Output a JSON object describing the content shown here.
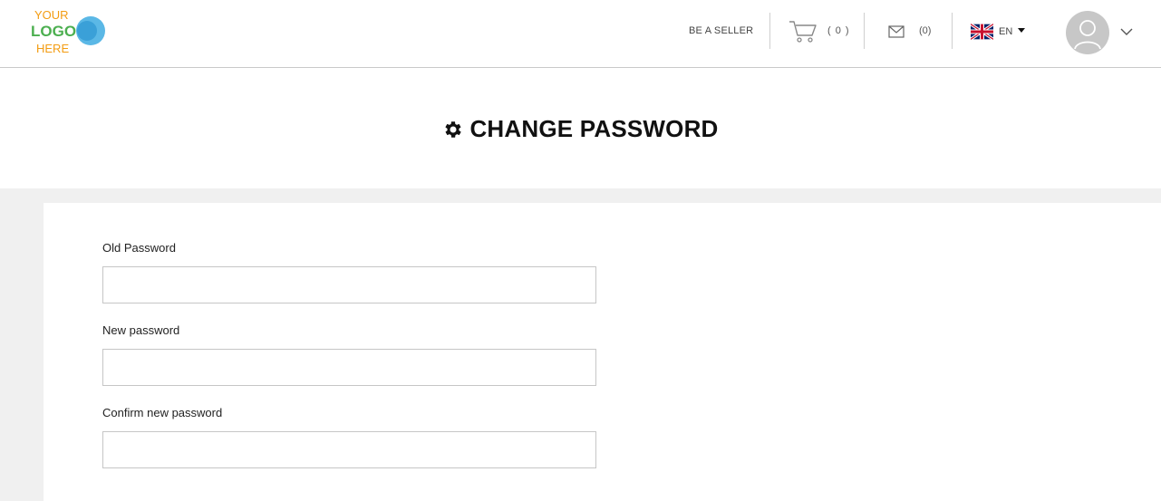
{
  "header": {
    "logo": {
      "text_lines": [
        "YOUR",
        "LOGO",
        "HERE"
      ],
      "colors": {
        "orange": "#f39c12",
        "green": "#4caf50",
        "blue": "#3aa0d8"
      }
    },
    "be_seller_label": "BE A SELLER",
    "cart": {
      "icon": "cart-icon",
      "count_label": "( 0 )"
    },
    "messages": {
      "icon": "envelope-icon",
      "count_label": "(0)"
    },
    "language": {
      "icon": "uk-flag-icon",
      "code": "EN"
    },
    "user": {
      "icon": "avatar-icon",
      "menu_icon": "chevron-down-icon"
    }
  },
  "page": {
    "title_icon": "gear-icon",
    "title": "CHANGE PASSWORD"
  },
  "form": {
    "fields": [
      {
        "label": "Old Password",
        "value": ""
      },
      {
        "label": "New password",
        "value": ""
      },
      {
        "label": "Confirm new password",
        "value": ""
      }
    ]
  },
  "colors": {
    "page_bg_grey": "#f0f0f0",
    "border": "#c6c6c6",
    "text": "#222222"
  }
}
